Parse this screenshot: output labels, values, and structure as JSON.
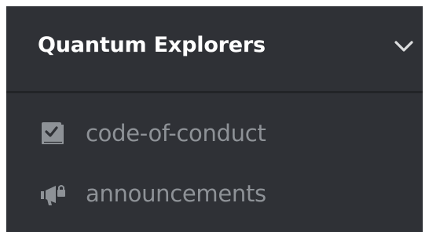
{
  "server": {
    "name": "Quantum Explorers",
    "menu_icon": "chevron-down-icon"
  },
  "channels": [
    {
      "label": "code-of-conduct",
      "icon": "rules-icon"
    },
    {
      "label": "announcements",
      "icon": "announcement-icon"
    }
  ],
  "colors": {
    "sidebar_bg": "#2f3136",
    "header_divider": "#222427",
    "server_name": "#ffffff",
    "channel_text": "#8e9297"
  }
}
